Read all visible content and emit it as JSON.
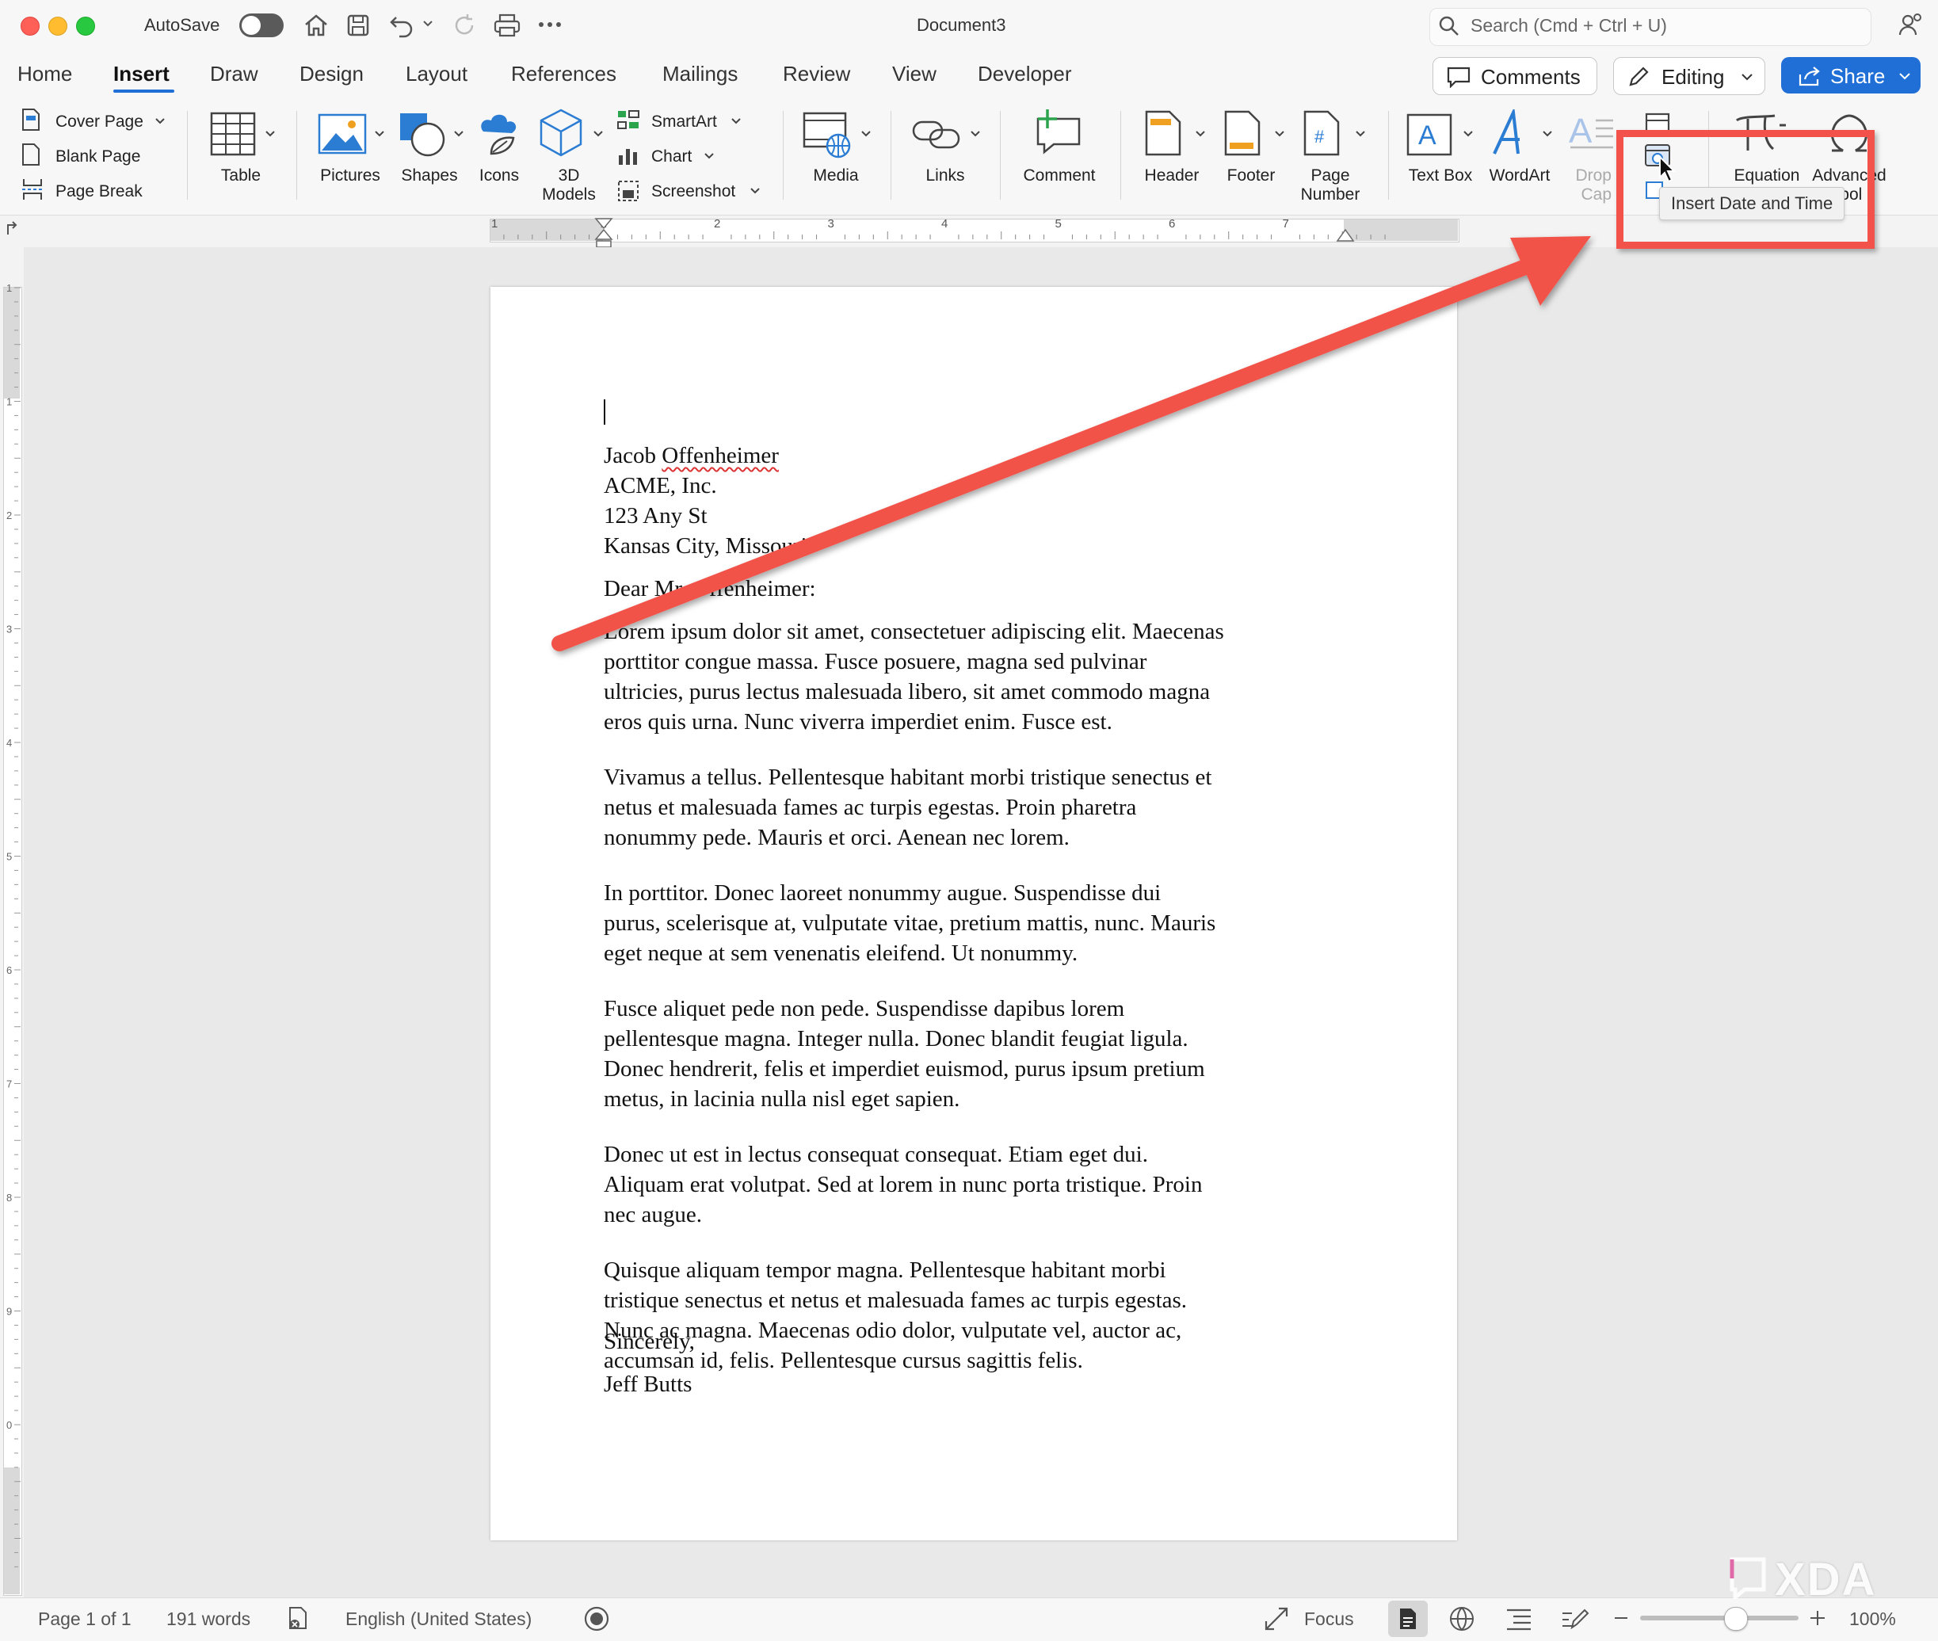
{
  "titlebar": {
    "autosave_label": "AutoSave",
    "document_title": "Document3",
    "search_placeholder": "Search (Cmd + Ctrl + U)"
  },
  "tabs": [
    "Home",
    "Insert",
    "Draw",
    "Design",
    "Layout",
    "References",
    "Mailings",
    "Review",
    "View",
    "Developer"
  ],
  "active_tab": "Insert",
  "header_buttons": {
    "comments": "Comments",
    "editing": "Editing",
    "share": "Share"
  },
  "ribbon": {
    "pages": [
      "Cover Page",
      "Blank Page",
      "Page Break"
    ],
    "table": "Table",
    "pictures": "Pictures",
    "shapes": "Shapes",
    "icons": "Icons",
    "models_line1": "3D",
    "models_line2": "Models",
    "smartart": "SmartArt",
    "chart": "Chart",
    "screenshot": "Screenshot",
    "media": "Media",
    "links": "Links",
    "comment": "Comment",
    "header": "Header",
    "footer": "Footer",
    "page_number_line1": "Page",
    "page_number_line2": "Number",
    "text_box": "Text Box",
    "wordart": "WordArt",
    "drop_cap_line1": "Drop",
    "drop_cap_line2": "Cap",
    "equation": "Equation",
    "advanced_line1": "Advanced",
    "advanced_line2": "ibol"
  },
  "tooltip": "Insert Date and Time",
  "ruler_numbers": [
    "1",
    "1",
    "2",
    "3",
    "4",
    "5",
    "6",
    "7"
  ],
  "vruler_numbers": [
    "1",
    "1",
    "2",
    "3",
    "4",
    "5",
    "6",
    "7",
    "8",
    "9",
    "0"
  ],
  "document": {
    "address": [
      "Jacob Offenheimer",
      "ACME, Inc.",
      "123 Any St",
      "Kansas City, Missouri"
    ],
    "salutation": "Dear Mr. Offenheimer:",
    "paragraphs": [
      [
        "Lorem ipsum dolor sit amet, consectetuer adipiscing elit. Maecenas",
        "porttitor congue massa. Fusce posuere, magna sed pulvinar",
        "ultricies, purus lectus malesuada libero, sit amet commodo magna",
        "eros quis urna. Nunc viverra imperdiet enim. Fusce est."
      ],
      [
        "Vivamus a tellus. Pellentesque habitant morbi tristique senectus et",
        "netus et malesuada fames ac turpis egestas. Proin pharetra",
        "nonummy pede. Mauris et orci. Aenean nec lorem."
      ],
      [
        "In porttitor. Donec laoreet nonummy augue. Suspendisse dui",
        "purus, scelerisque at, vulputate vitae, pretium mattis, nunc. Mauris",
        "eget neque at sem venenatis eleifend. Ut nonummy."
      ],
      [
        "Fusce aliquet pede non pede. Suspendisse dapibus lorem",
        "pellentesque magna. Integer nulla. Donec blandit feugiat ligula.",
        "Donec hendrerit, felis et imperdiet euismod, purus ipsum pretium",
        "metus, in lacinia nulla nisl eget sapien."
      ],
      [
        "Donec ut est in lectus consequat consequat. Etiam eget dui.",
        "Aliquam erat volutpat. Sed at lorem in nunc porta tristique. Proin",
        "nec augue."
      ],
      [
        "Quisque aliquam tempor magna. Pellentesque habitant morbi",
        "tristique senectus et netus et malesuada fames ac turpis egestas.",
        "Nunc ac magna. Maecenas odio dolor, vulputate vel, auctor ac,",
        "accumsan id, felis. Pellentesque cursus sagittis felis."
      ]
    ],
    "closing": "Sincerely,",
    "signature": "Jeff Butts"
  },
  "statusbar": {
    "page": "Page 1 of 1",
    "words": "191 words",
    "language": "English (United States)",
    "focus": "Focus",
    "zoom": "100%",
    "zoom_level": 1.0
  },
  "watermark": "XDA",
  "colors": {
    "accent_blue": "#1f6fd6",
    "annotation_red": "#f2524a",
    "icon_blue": "#2b7cd3"
  }
}
